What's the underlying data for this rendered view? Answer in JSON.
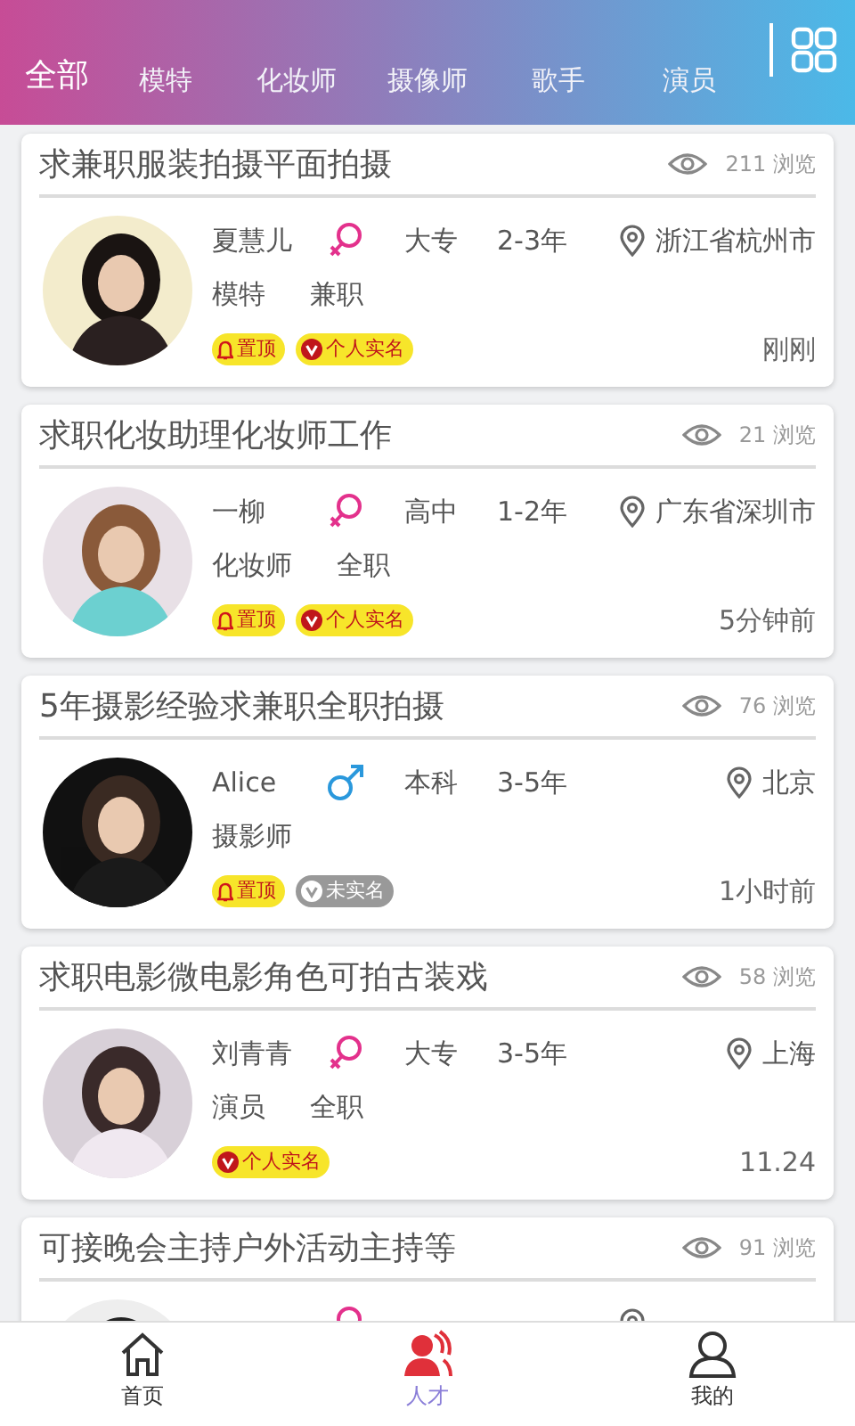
{
  "tabs": [
    {
      "label": "全部",
      "selected": true
    },
    {
      "label": "模特",
      "selected": false
    },
    {
      "label": "化妆师",
      "selected": false
    },
    {
      "label": "摄像师",
      "selected": false
    },
    {
      "label": "歌手",
      "selected": false
    },
    {
      "label": "演员",
      "selected": false
    }
  ],
  "posts": [
    {
      "title": "求兼职服装拍摄平面拍摄",
      "views": "211 浏览",
      "name": "夏慧儿",
      "gender": {
        "kind": "female"
      },
      "education": "大专",
      "experience": "2-3年",
      "location": "浙江省杭州市",
      "tags": [
        "模特",
        "兼职"
      ],
      "badges": [
        {
          "kind": "top",
          "label": "置顶"
        },
        {
          "kind": "verified",
          "label": "个人实名"
        }
      ],
      "time": "刚刚",
      "avatar": {
        "kind": "picture"
      }
    },
    {
      "title": "求职化妆助理化妆师工作",
      "views": "21 浏览",
      "name": "一柳",
      "gender": {
        "kind": "female"
      },
      "education": "高中",
      "experience": "1-2年",
      "location": "广东省深圳市",
      "tags": [
        "化妆师",
        "全职"
      ],
      "badges": [
        {
          "kind": "top",
          "label": "置顶"
        },
        {
          "kind": "verified",
          "label": "个人实名"
        }
      ],
      "time": "5分钟前",
      "avatar": {
        "kind": "picture"
      }
    },
    {
      "title": "5年摄影经验求兼职全职拍摄",
      "views": "76 浏览",
      "name": "Alice",
      "gender": {
        "kind": "male"
      },
      "education": "本科",
      "experience": "3-5年",
      "location": "北京",
      "tags": [
        "摄影师"
      ],
      "badges": [
        {
          "kind": "top",
          "label": "置顶"
        },
        {
          "kind": "unverified",
          "label": "未实名"
        }
      ],
      "time": "1小时前",
      "avatar": {
        "kind": "picture"
      }
    },
    {
      "title": "求职电影微电影角色可拍古装戏",
      "views": "58 浏览",
      "name": "刘青青",
      "gender": {
        "kind": "female"
      },
      "education": "大专",
      "experience": "3-5年",
      "location": "上海",
      "tags": [
        "演员",
        "全职"
      ],
      "badges": [
        {
          "kind": "verified",
          "label": "个人实名"
        }
      ],
      "time": "11.24",
      "avatar": {
        "kind": "picture"
      }
    },
    {
      "title": "可接晚会主持户外活动主持等",
      "views": "91 浏览",
      "gender": {
        "kind": "female"
      },
      "avatar": {
        "kind": "picture"
      }
    }
  ],
  "nav": [
    {
      "label": "首页",
      "kind": "home",
      "selected": false
    },
    {
      "label": "人才",
      "kind": "talent",
      "selected": true
    },
    {
      "label": "我的",
      "kind": "me",
      "selected": false
    }
  ]
}
